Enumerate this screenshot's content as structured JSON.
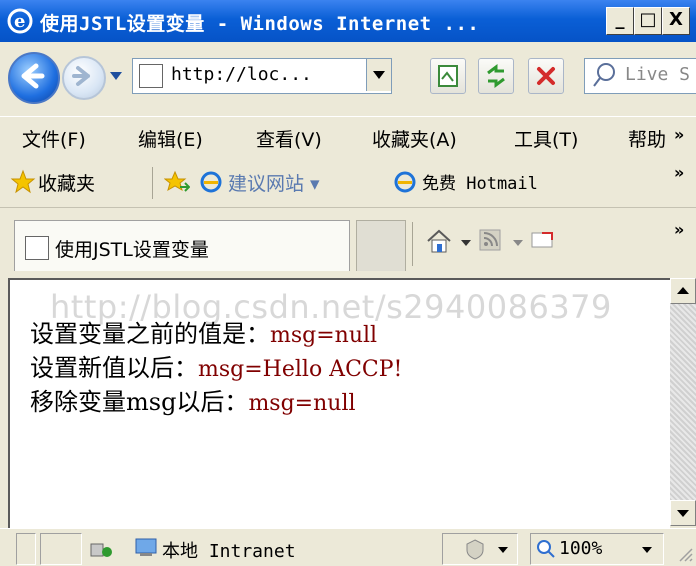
{
  "window": {
    "title": "使用JSTL设置变量 - Windows Internet ...",
    "minimize_label": "_",
    "maximize_label": "□",
    "close_label": "X"
  },
  "navbar": {
    "address": "http://loc...",
    "search_placeholder": "Live S"
  },
  "menubar": {
    "items": [
      "文件(F)",
      "编辑(E)",
      "查看(V)",
      "收藏夹(A)",
      "工具(T)",
      "帮助"
    ],
    "overflow": "»"
  },
  "favorites_bar": {
    "favorites_label": "收藏夹",
    "suggested_sites": "建议网站 ▾",
    "hotmail": "免费 Hotmail",
    "overflow": "»"
  },
  "tabs": {
    "active_title": "使用JSTL设置变量",
    "overflow": "»"
  },
  "content": {
    "watermark": "http://blog.csdn.net/s2940086379",
    "lines": [
      {
        "label": "设置变量之前的值是：",
        "value": "msg=null"
      },
      {
        "label": "设置新值以后：",
        "value": "msg=Hello ACCP!"
      },
      {
        "label": "移除变量msg以后：",
        "value": "msg=null"
      }
    ]
  },
  "statusbar": {
    "zone": "本地 Intranet",
    "zoom": "100%"
  },
  "colors": {
    "titlebar": "#0a5fd6",
    "chrome": "#ece9d8",
    "content_value_color": "#800000"
  }
}
